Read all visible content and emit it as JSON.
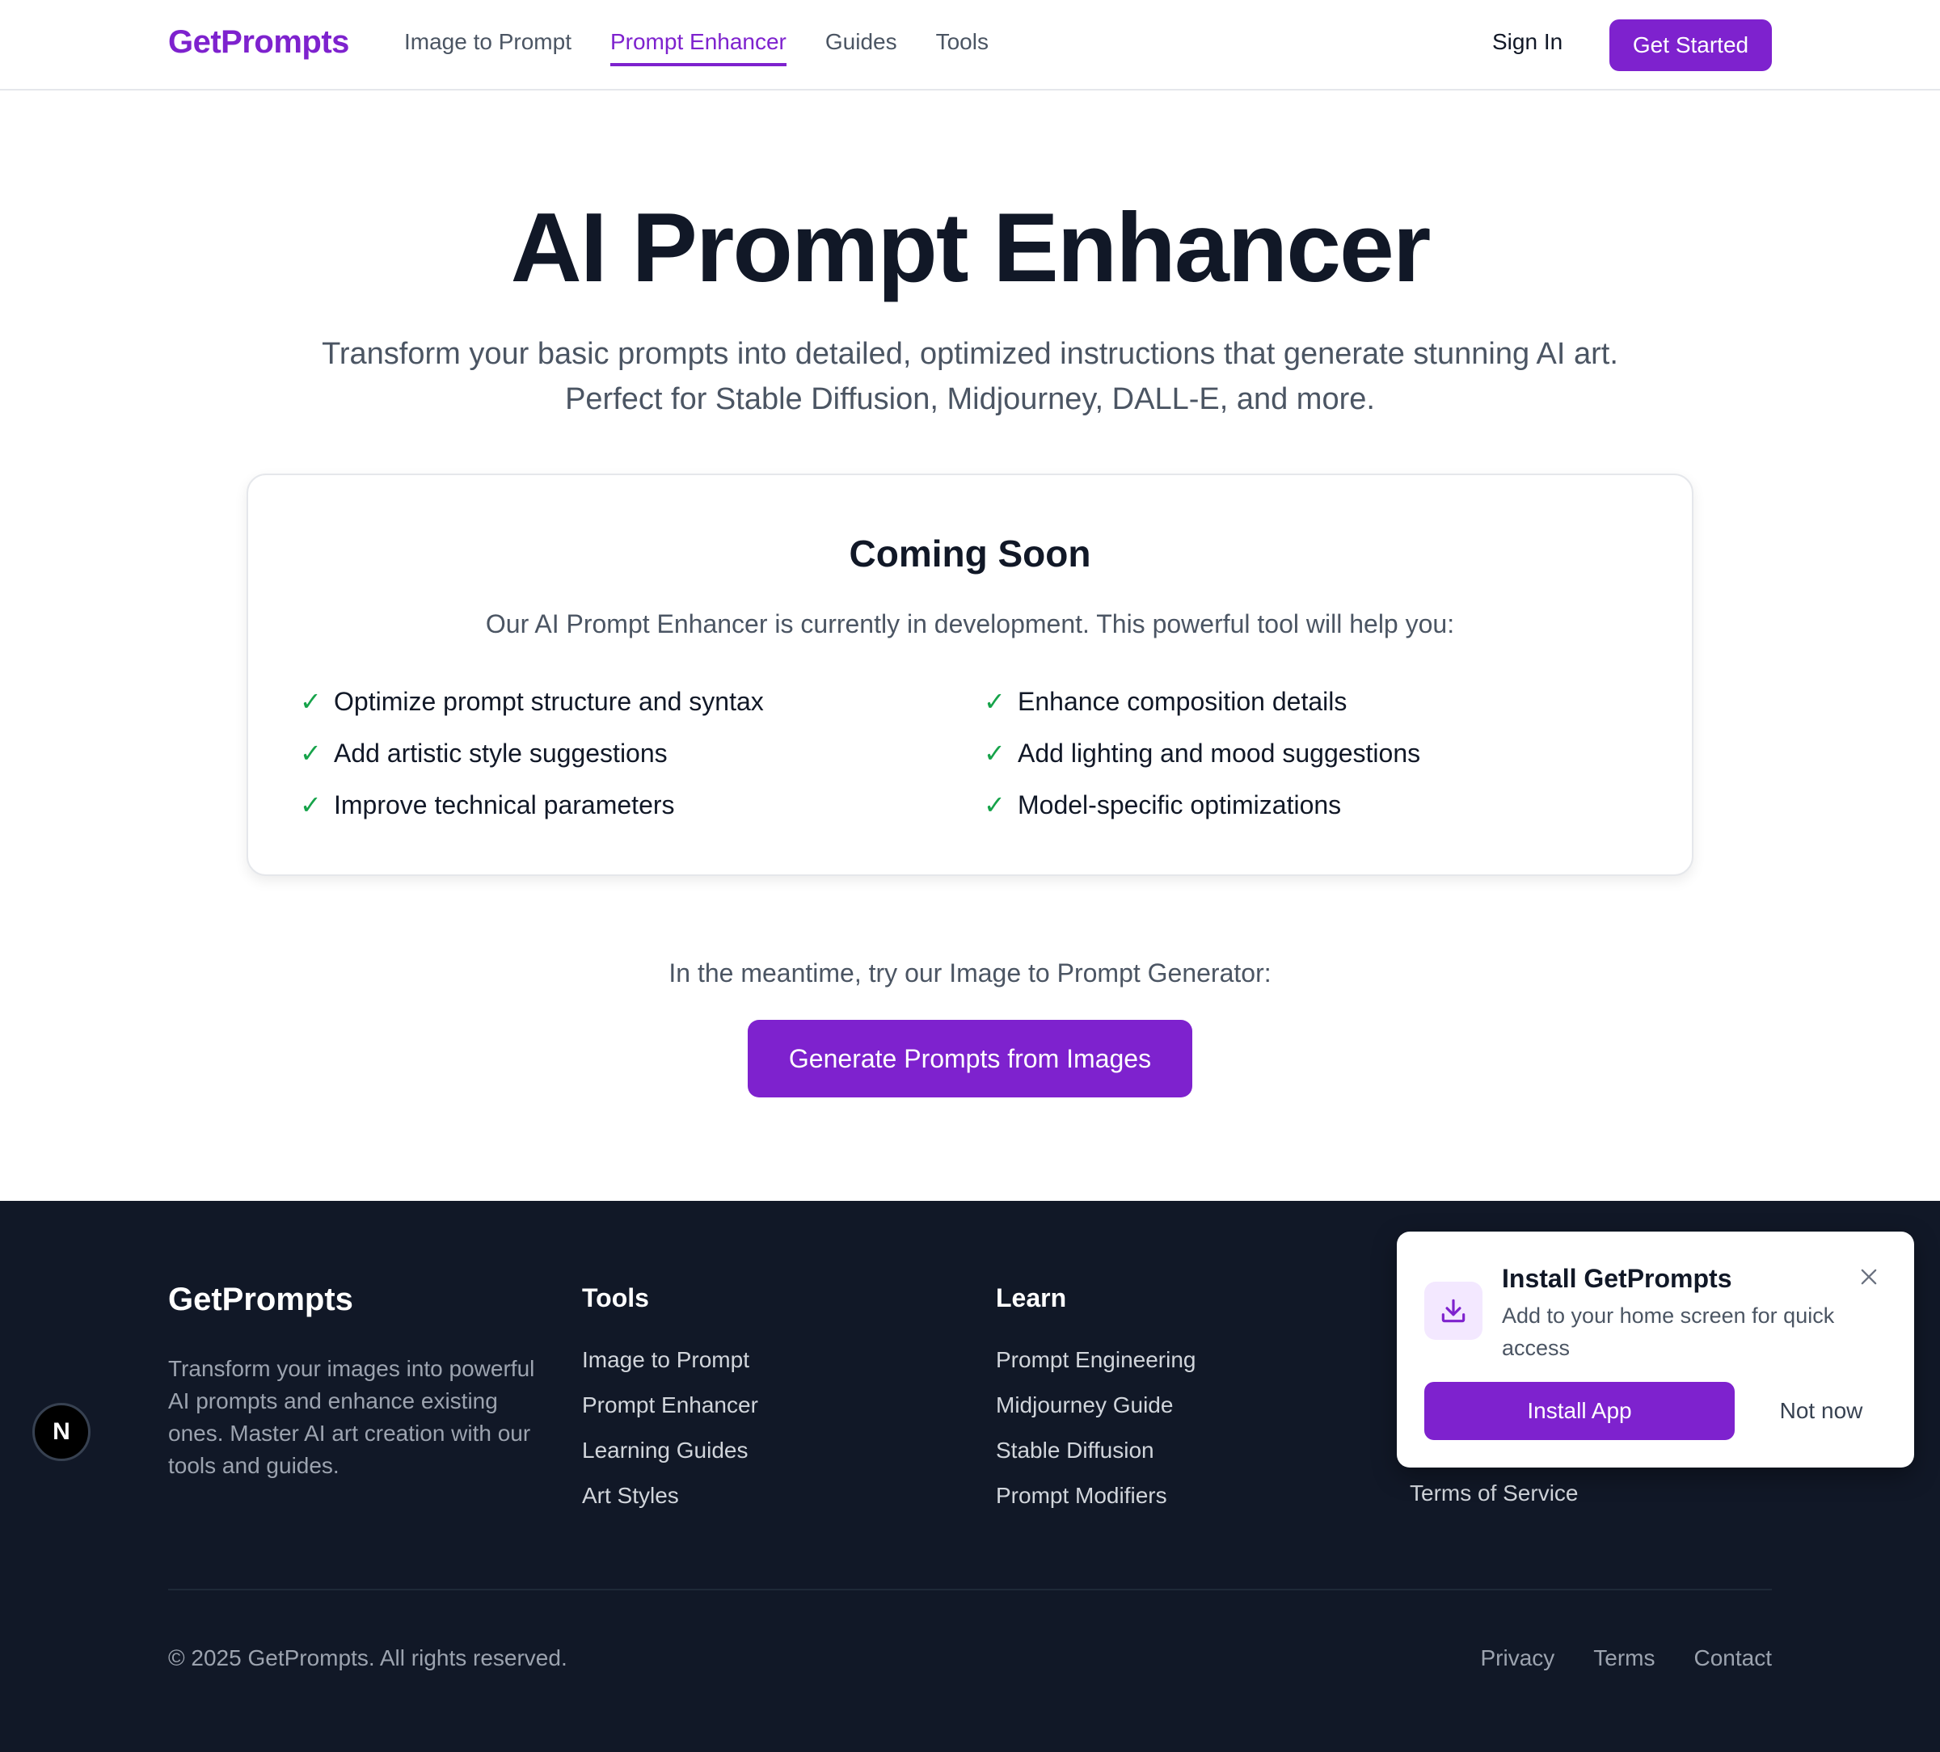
{
  "header": {
    "brand": "GetPrompts",
    "nav": [
      {
        "label": "Image to Prompt",
        "active": false
      },
      {
        "label": "Prompt Enhancer",
        "active": true
      },
      {
        "label": "Guides",
        "active": false
      },
      {
        "label": "Tools",
        "active": false
      }
    ],
    "sign_in": "Sign In",
    "get_started": "Get Started"
  },
  "hero": {
    "title": "AI Prompt Enhancer",
    "subtitle_line1": "Transform your basic prompts into detailed, optimized instructions that generate stunning AI art.",
    "subtitle_line2": "Perfect for Stable Diffusion, Midjourney, DALL-E, and more."
  },
  "card": {
    "title": "Coming Soon",
    "description": "Our AI Prompt Enhancer is currently in development. This powerful tool will help you:",
    "features": [
      "Optimize prompt structure and syntax",
      "Enhance composition details",
      "Add artistic style suggestions",
      "Add lighting and mood suggestions",
      "Improve technical parameters",
      "Model-specific optimizations"
    ],
    "check_glyph": "✓"
  },
  "cta": {
    "text": "In the meantime, try our Image to Prompt Generator:",
    "button": "Generate Prompts from Images"
  },
  "footer": {
    "brand": "GetPrompts",
    "description": "Transform your images into powerful AI prompts and enhance existing ones. Master AI art creation with our tools and guides.",
    "columns": [
      {
        "title": "Tools",
        "links": [
          "Image to Prompt",
          "Prompt Enhancer",
          "Learning Guides",
          "Art Styles"
        ]
      },
      {
        "title": "Learn",
        "links": [
          "Prompt Engineering",
          "Midjourney Guide",
          "Stable Diffusion",
          "Prompt Modifiers"
        ]
      }
    ],
    "partial_link": "Terms of Service",
    "copyright": "© 2025 GetPrompts. All rights reserved.",
    "bottom_links": [
      "Privacy",
      "Terms",
      "Contact"
    ]
  },
  "badge": {
    "letter": "N"
  },
  "install_popup": {
    "title": "Install GetPrompts",
    "text": "Add to your home screen for quick access",
    "install_button": "Install App",
    "dismiss_button": "Not now"
  },
  "colors": {
    "accent": "#7e22ce",
    "footer_bg": "#111827",
    "check": "#16a34a"
  },
  "icons": [
    "download-icon",
    "close-icon",
    "check-icon"
  ]
}
